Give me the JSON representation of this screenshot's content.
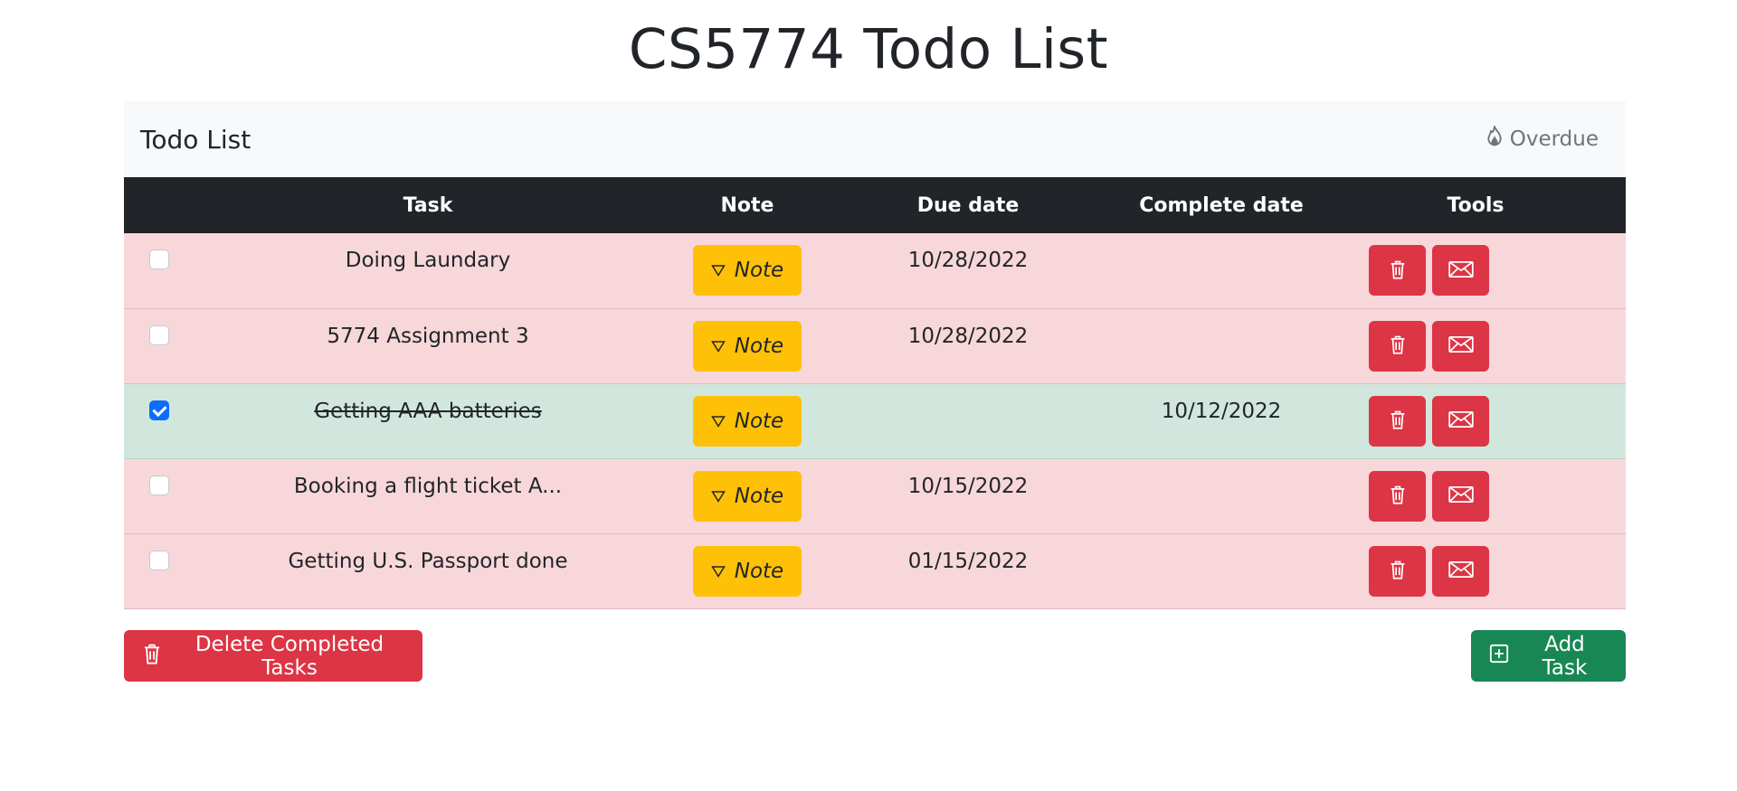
{
  "page": {
    "title": "CS5774 Todo List"
  },
  "card": {
    "heading": "Todo List",
    "overdue_label": "Overdue"
  },
  "table": {
    "columns": [
      "Task",
      "Note",
      "Due date",
      "Complete date",
      "Tools"
    ],
    "rows": [
      {
        "checked": false,
        "task": "Doing Laundary",
        "note_label": "Note",
        "due_date": "10/28/2022",
        "complete_date": "",
        "status": "overdue"
      },
      {
        "checked": false,
        "task": "5774 Assignment 3",
        "note_label": "Note",
        "due_date": "10/28/2022",
        "complete_date": "",
        "status": "overdue"
      },
      {
        "checked": true,
        "task": "Getting AAA batteries",
        "note_label": "Note",
        "due_date": "",
        "complete_date": "10/12/2022",
        "status": "completed"
      },
      {
        "checked": false,
        "task": "Booking a flight ticket A...",
        "note_label": "Note",
        "due_date": "10/15/2022",
        "complete_date": "",
        "status": "overdue"
      },
      {
        "checked": false,
        "task": "Getting U.S. Passport done",
        "note_label": "Note",
        "due_date": "01/15/2022",
        "complete_date": "",
        "status": "overdue"
      }
    ]
  },
  "actions": {
    "delete_completed_label": "Delete Completed Tasks",
    "add_task_label": "Add Task"
  },
  "colors": {
    "overdue_row": "#f8d7da",
    "completed_row": "#d1e7dd",
    "header_bg": "#212529",
    "note_button": "#ffc107",
    "danger": "#dc3545",
    "success": "#198754",
    "checkbox_checked": "#0d6efd"
  },
  "icons": {
    "overdue": "fire-icon",
    "note": "triangle-down-icon",
    "delete": "trash-icon",
    "email": "envelope-icon",
    "add": "plus-square-icon"
  }
}
